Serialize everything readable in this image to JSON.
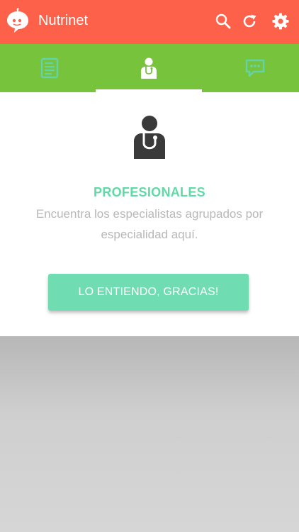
{
  "app": {
    "title": "Nutrinet",
    "colors": {
      "appbar": "#fd614a",
      "tabbar": "#77c43c",
      "accent": "#6fdcb1",
      "title_text": "#5fd9a6"
    }
  },
  "appbar": {
    "logo_icon": "nutrinet-logo-icon",
    "actions": [
      {
        "icon": "search-icon"
      },
      {
        "icon": "refresh-icon"
      },
      {
        "icon": "gear-icon"
      }
    ]
  },
  "tabs": [
    {
      "icon": "document-icon",
      "selected": false
    },
    {
      "icon": "doctor-icon",
      "selected": true
    },
    {
      "icon": "chat-icon",
      "selected": false
    }
  ],
  "intro_card": {
    "icon": "doctor-icon",
    "title": "PROFESIONALES",
    "description": "Encuentra los especialistas agrupados por especialidad aquí.",
    "button_label": "LO ENTIENDO, GRACIAS!"
  }
}
